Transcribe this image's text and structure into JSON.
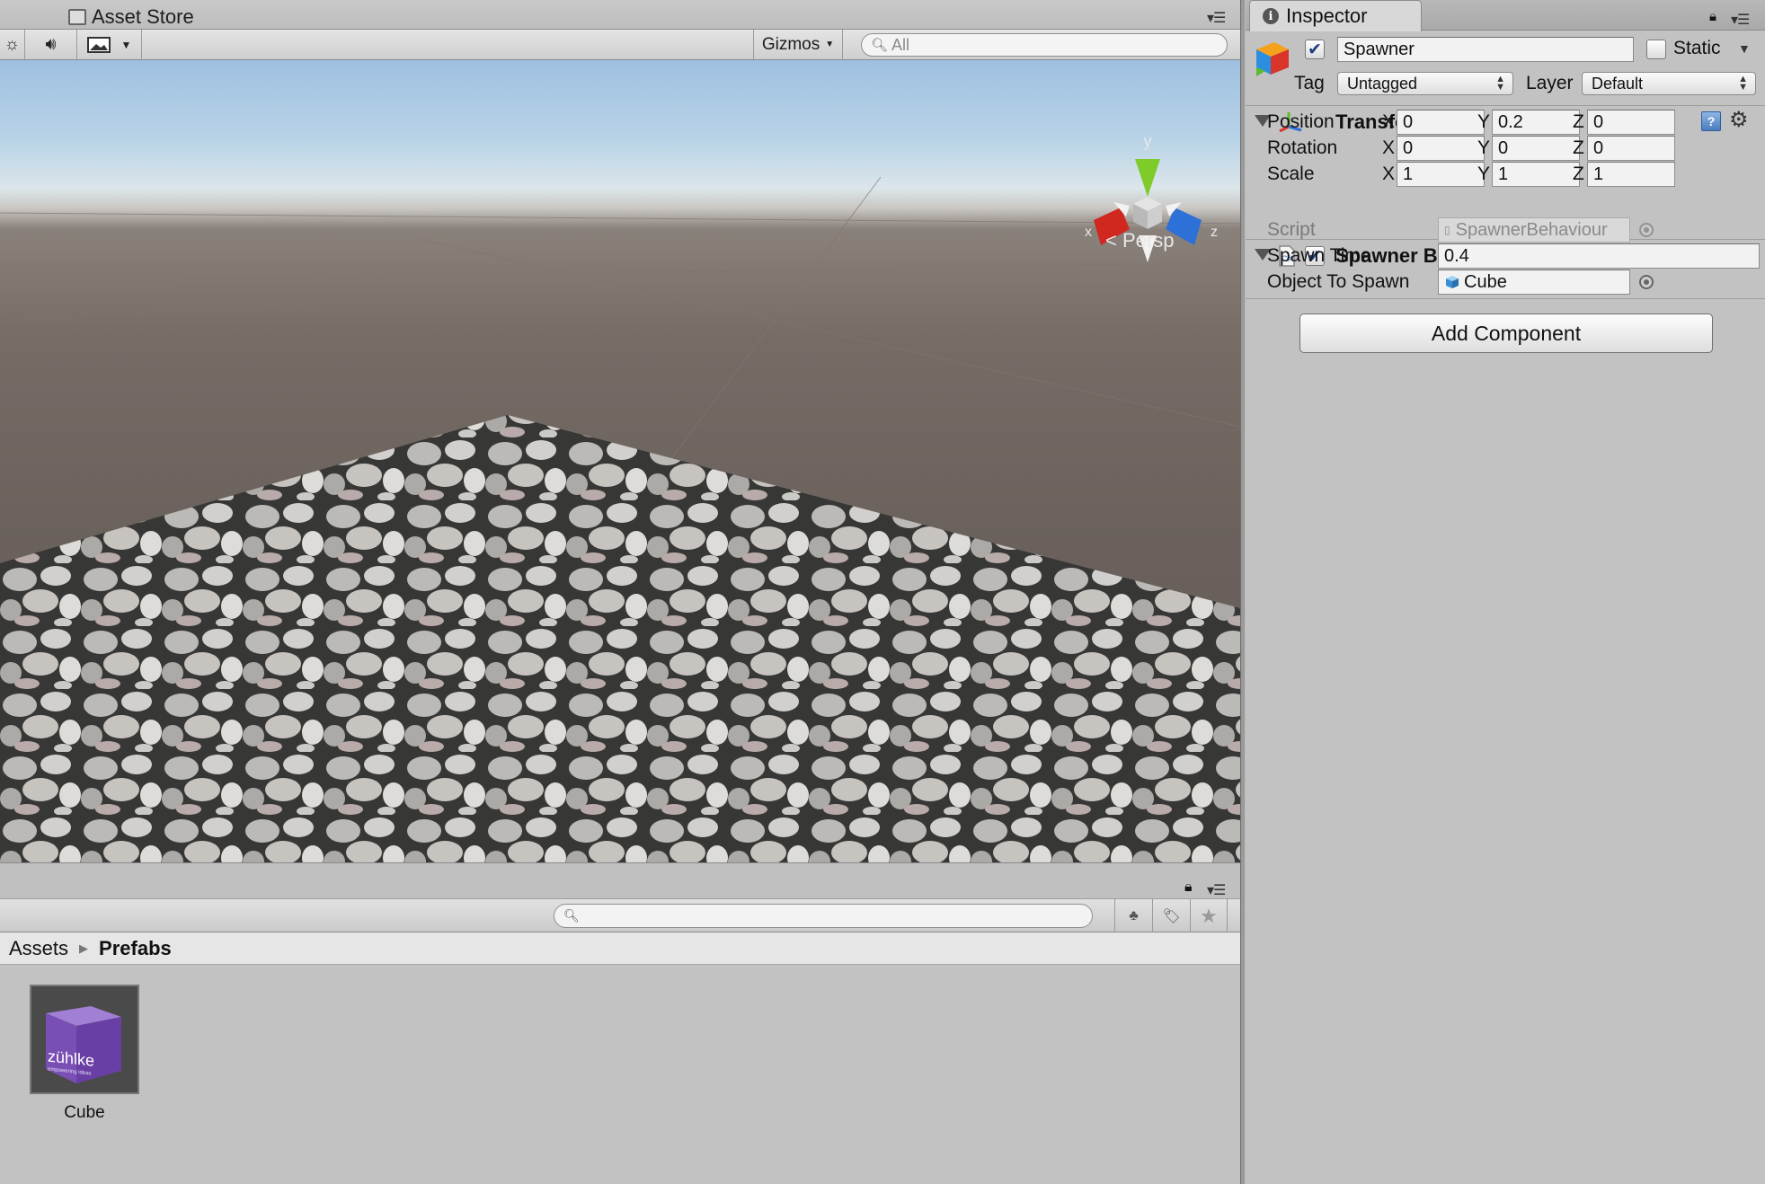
{
  "scene_window": {
    "tab_title": "Asset Store",
    "gizmos_label": "Gizmos",
    "search_placeholder": "All",
    "projection_label": "Persp",
    "gizmo_axes": {
      "y": "y",
      "x": "x",
      "z": "z"
    }
  },
  "project_window": {
    "breadcrumb": [
      "Assets",
      "Prefabs"
    ],
    "assets": [
      {
        "name": "Cube",
        "thumbnail_text": "zühlke",
        "thumbnail_tagline": "empowering ideas"
      }
    ]
  },
  "inspector": {
    "tab_title": "Inspector",
    "object_name": "Spawner",
    "object_active": true,
    "static_label": "Static",
    "static_checked": false,
    "tag_label": "Tag",
    "tag_value": "Untagged",
    "layer_label": "Layer",
    "layer_value": "Default",
    "transform": {
      "title": "Transform",
      "rows": [
        {
          "label": "Position",
          "x": "0",
          "y": "0.2",
          "z": "0"
        },
        {
          "label": "Rotation",
          "x": "0",
          "y": "0",
          "z": "0"
        },
        {
          "label": "Scale",
          "x": "1",
          "y": "1",
          "z": "1"
        }
      ],
      "axis_labels": {
        "x": "X",
        "y": "Y",
        "z": "Z"
      }
    },
    "script_component": {
      "title": "Spawner Behaviour (Script)",
      "enabled": true,
      "script_label": "Script",
      "script_value": "SpawnerBehaviour",
      "spawn_time_label": "Spawn Time",
      "spawn_time_value": "0.4",
      "object_to_spawn_label": "Object To Spawn",
      "object_to_spawn_value": "Cube"
    },
    "add_component_label": "Add Component"
  },
  "colors": {
    "panel_bg": "#c2c2c2",
    "sky_top": "#9ec0e0",
    "ground": "#6a615c",
    "gizmo_x": "#d0271e",
    "gizmo_y": "#7ecb29",
    "gizmo_z": "#2d70d8",
    "thumbnail_purple": "#7a4fb5"
  }
}
